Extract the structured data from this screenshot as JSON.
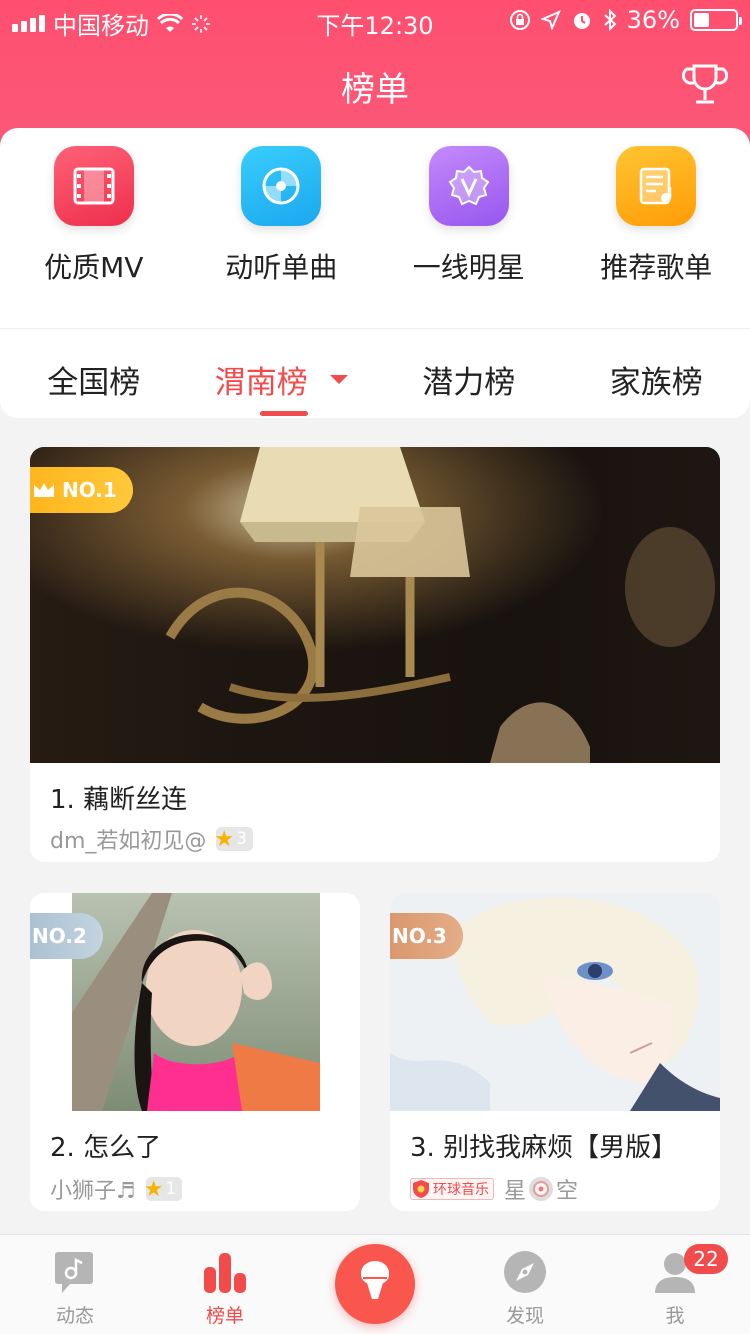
{
  "status": {
    "carrier": "中国移动",
    "time": "下午12:30",
    "battery": "36%"
  },
  "header": {
    "title": "榜单"
  },
  "categories": [
    {
      "label": "优质MV",
      "icon": "film-icon",
      "color": "#f6465c"
    },
    {
      "label": "动听单曲",
      "icon": "disc-icon",
      "color": "#27b6f1"
    },
    {
      "label": "一线明星",
      "icon": "vip-badge-icon",
      "color": "#a96df2"
    },
    {
      "label": "推荐歌单",
      "icon": "playlist-icon",
      "color": "#ffae12"
    }
  ],
  "rank_tabs": [
    {
      "label": "全国榜",
      "active": false
    },
    {
      "label": "渭南榜",
      "active": true
    },
    {
      "label": "潜力榜",
      "active": false
    },
    {
      "label": "家族榜",
      "active": false
    }
  ],
  "entries": [
    {
      "rank_badge": "NO.1",
      "title": "1. 藕断丝连",
      "user": "dm_若如初见@",
      "stars": "3"
    },
    {
      "rank_badge": "NO.2",
      "title": "2. 怎么了",
      "user": "小狮子♬",
      "stars": "1"
    },
    {
      "rank_badge": "NO.3",
      "title": "3. 别找我麻烦【男版】",
      "tag": "环球音乐",
      "user": "星",
      "user_suffix": "空"
    }
  ],
  "tabbar": {
    "items": [
      {
        "label": "动态",
        "icon": "music-note-icon",
        "active": false
      },
      {
        "label": "榜单",
        "icon": "chart-icon",
        "active": true
      },
      {
        "label": "",
        "icon": "microphone-icon",
        "active": false
      },
      {
        "label": "发现",
        "icon": "compass-icon",
        "active": false
      },
      {
        "label": "我",
        "icon": "user-icon",
        "active": false
      }
    ],
    "badge_count": "22"
  }
}
